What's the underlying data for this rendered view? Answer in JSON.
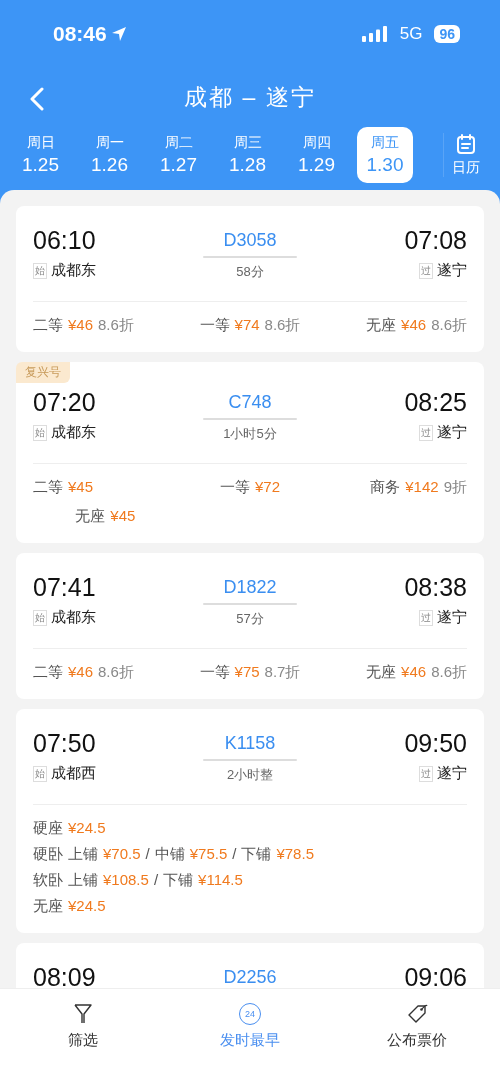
{
  "status_bar": {
    "time": "08:46",
    "network": "5G",
    "battery": "96"
  },
  "header": {
    "title": "成都 – 遂宁"
  },
  "date_tabs": [
    {
      "day": "周日",
      "date": "1.25",
      "selected": false
    },
    {
      "day": "周一",
      "date": "1.26",
      "selected": false
    },
    {
      "day": "周二",
      "date": "1.27",
      "selected": false
    },
    {
      "day": "周三",
      "date": "1.28",
      "selected": false
    },
    {
      "day": "周四",
      "date": "1.29",
      "selected": false
    },
    {
      "day": "周五",
      "date": "1.30",
      "selected": true
    }
  ],
  "calendar_button": {
    "label": "日历"
  },
  "trains": [
    {
      "depart": "06:10",
      "arrive": "07:08",
      "number": "D3058",
      "duration": "58分",
      "from_tag": "始",
      "from": "成都东",
      "to_tag": "过",
      "to": "遂宁",
      "kind": "row",
      "fares": [
        {
          "seat": "二等",
          "price": "¥46",
          "discount": "8.6折"
        },
        {
          "seat": "一等",
          "price": "¥74",
          "discount": "8.6折"
        },
        {
          "seat": "无座",
          "price": "¥46",
          "discount": "8.6折"
        }
      ]
    },
    {
      "badge": "复兴号",
      "depart": "07:20",
      "arrive": "08:25",
      "number": "C748",
      "duration": "1小时5分",
      "from_tag": "始",
      "from": "成都东",
      "to_tag": "过",
      "to": "遂宁",
      "kind": "row",
      "fares": [
        {
          "seat": "二等",
          "price": "¥45"
        },
        {
          "seat": "一等",
          "price": "¥72"
        },
        {
          "seat": "商务",
          "price": "¥142",
          "discount": "9折"
        },
        {
          "seat": "无座",
          "price": "¥45"
        }
      ]
    },
    {
      "depart": "07:41",
      "arrive": "08:38",
      "number": "D1822",
      "duration": "57分",
      "from_tag": "始",
      "from": "成都东",
      "to_tag": "过",
      "to": "遂宁",
      "kind": "row",
      "fares": [
        {
          "seat": "二等",
          "price": "¥46",
          "discount": "8.6折"
        },
        {
          "seat": "一等",
          "price": "¥75",
          "discount": "8.7折"
        },
        {
          "seat": "无座",
          "price": "¥46",
          "discount": "8.6折"
        }
      ]
    },
    {
      "depart": "07:50",
      "arrive": "09:50",
      "number": "K1158",
      "duration": "2小时整",
      "from_tag": "始",
      "from": "成都西",
      "to_tag": "过",
      "to": "遂宁",
      "kind": "lines",
      "lines": [
        {
          "seat": "硬座",
          "fares": [
            {
              "price": "¥24.5"
            }
          ]
        },
        {
          "seat": "硬卧",
          "separator": "/",
          "fares": [
            {
              "berth": "上铺",
              "price": "¥70.5"
            },
            {
              "berth": "中铺",
              "price": "¥75.5"
            },
            {
              "berth": "下铺",
              "price": "¥78.5"
            }
          ]
        },
        {
          "seat": "软卧",
          "separator": "/",
          "fares": [
            {
              "berth": "上铺",
              "price": "¥108.5"
            },
            {
              "berth": "下铺",
              "price": "¥114.5"
            }
          ]
        },
        {
          "seat": "无座",
          "fares": [
            {
              "price": "¥24.5"
            }
          ]
        }
      ]
    },
    {
      "depart": "08:09",
      "arrive": "09:06",
      "number": "D2256"
    }
  ],
  "bottom_bar": [
    {
      "kind": "filter",
      "label": "筛选",
      "selected": false
    },
    {
      "kind": "clock",
      "label": "发时最早",
      "icon_text": "24",
      "selected": true
    },
    {
      "kind": "tag",
      "label": "公布票价",
      "selected": false
    }
  ]
}
